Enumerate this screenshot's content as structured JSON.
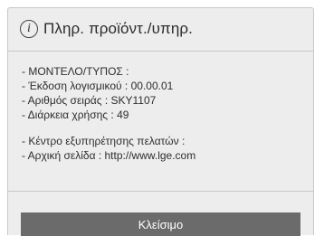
{
  "dialog": {
    "title": "Πληρ. προϊόντ./υπηρ.",
    "info_lines": [
      "- ΜΟΝΤΕΛΟ/ΤΥΠΟΣ :",
      "- Έκδοση λογισμικού : 00.00.01",
      "- Αριθμός σειράς : SKY1107",
      "- Διάρκεια χρήσης : 49"
    ],
    "service_lines": [
      "- Κέντρο εξυπηρέτησης πελατών :",
      "- Αρχική σελίδα : http://www.lge.com"
    ],
    "close_label": "Κλείσιμο"
  },
  "icons": {
    "title_icon": "info-icon",
    "title_icon_glyph": "i"
  },
  "colors": {
    "dialog_background": "#ededed",
    "button_background": "#6b6b6b",
    "button_text": "#ffffff",
    "text": "#2e2e2e"
  }
}
